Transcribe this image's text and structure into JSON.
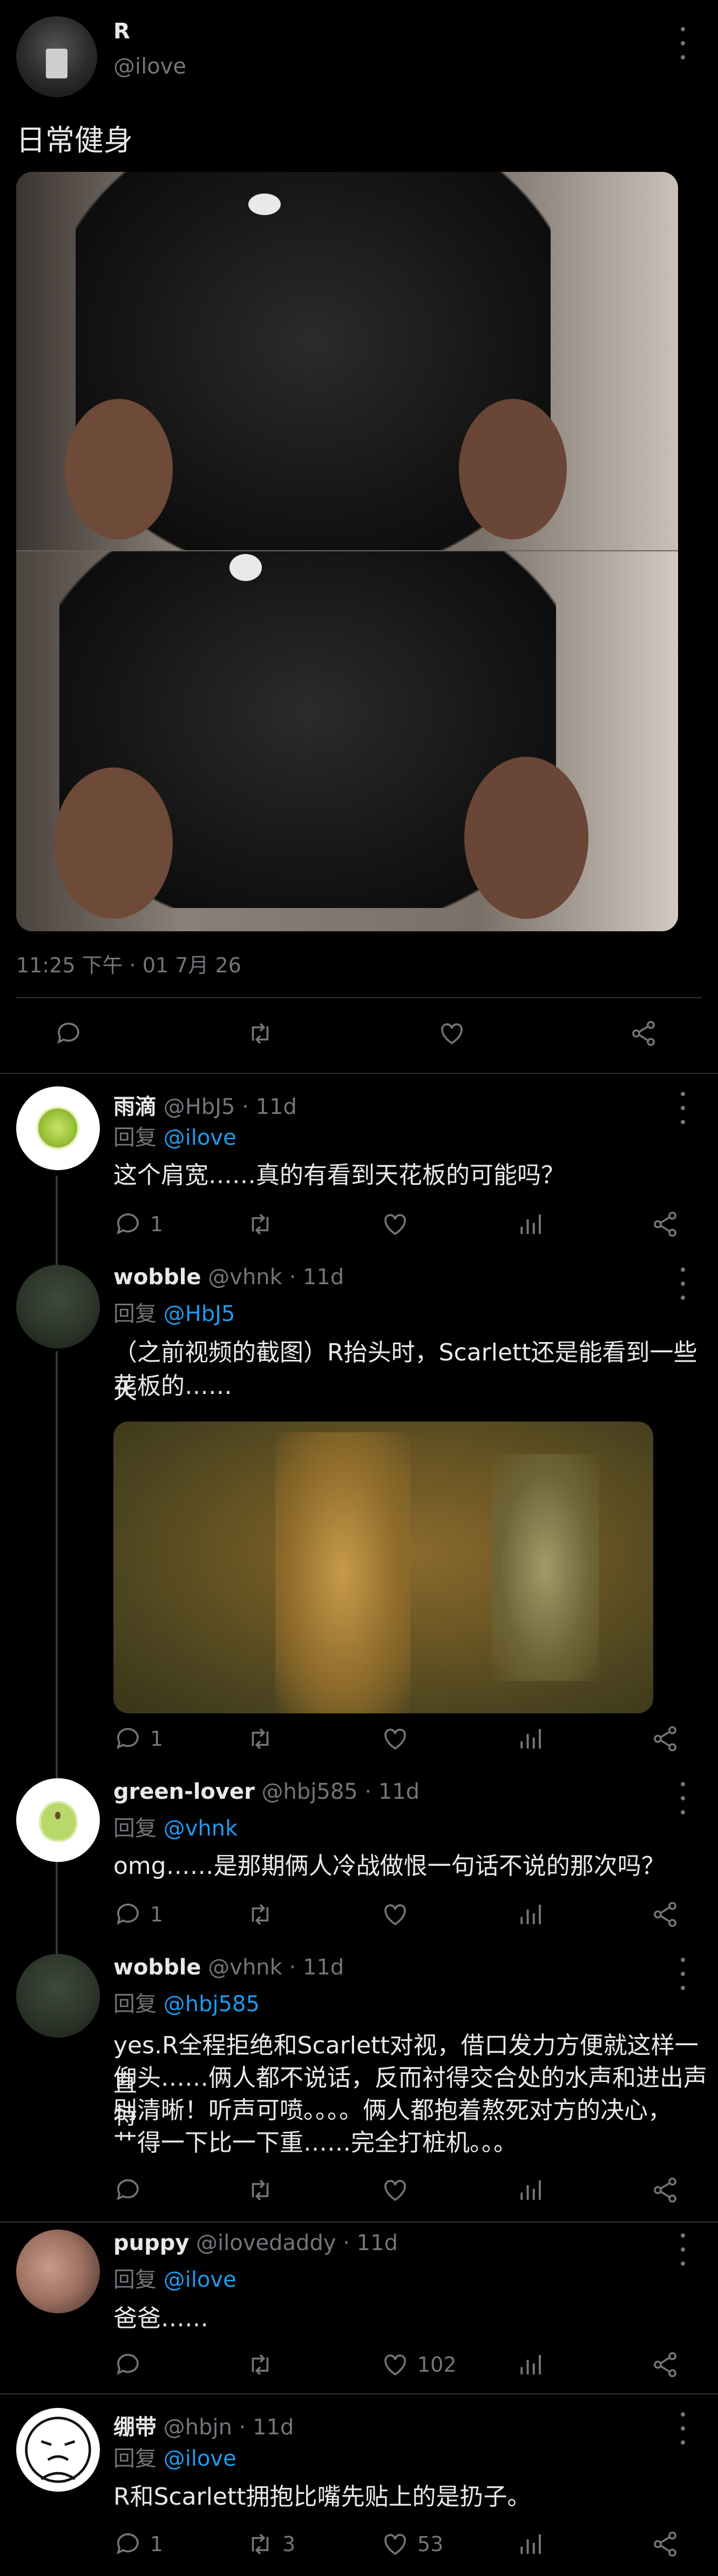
{
  "main_tweet": {
    "name": "R",
    "handle": "@ilove",
    "text": "日常健身",
    "timestamp": "11:25 下午 · 01 7月 26"
  },
  "replies": [
    {
      "name": "雨滴",
      "handle": "@HbJ5",
      "age": "· 11d",
      "reply_prefix": "回复",
      "reply_to": "@ilove",
      "text": "这个肩宽……真的有看到天花板的可能吗？",
      "comments": "1",
      "retweets": "",
      "likes": ""
    },
    {
      "name": "wobble",
      "handle": "@vhnk",
      "age": "· 11d",
      "reply_prefix": "回复",
      "reply_to": "@HbJ5",
      "text_line1": "（之前视频的截图）R抬头时，Scarlett还是能看到一些天",
      "text_line2": "花板的……",
      "comments": "1",
      "retweets": "",
      "likes": ""
    },
    {
      "name": "green-lover",
      "handle": "@hbj585",
      "age": "· 11d",
      "reply_prefix": "回复",
      "reply_to": "@vhnk",
      "text": "omg……是那期俩人冷战做恨一句话不说的那次吗？",
      "comments": "1",
      "retweets": "",
      "likes": ""
    },
    {
      "name": "wobble",
      "handle": "@vhnk",
      "age": "· 11d",
      "reply_prefix": "回复",
      "reply_to": "@hbj585",
      "text_line1": "yes.R全程拒绝和Scarlett对视，借口发力方便就这样一直",
      "text_line2": "仰头……俩人都不说话，反而衬得交合处的水声和进出声特",
      "text_line3": "别清晰！听声可喷。。。。俩人都抱着熬死对方的决心，",
      "text_line4": "艹得一下比一下重……完全打桩机。。。",
      "comments": "",
      "retweets": "",
      "likes": ""
    },
    {
      "name": "puppy",
      "handle": "@ilovedaddy",
      "age": "· 11d",
      "reply_prefix": "回复",
      "reply_to": "@ilove",
      "text": "爸爸……",
      "comments": "",
      "retweets": "",
      "likes": "102"
    },
    {
      "name": "绷带",
      "handle": "@hbjn",
      "age": "· 11d",
      "reply_prefix": "回复",
      "reply_to": "@ilove",
      "text": "R和Scarlett拥抱比嘴先贴上的是扔子。",
      "comments": "1",
      "retweets": "3",
      "likes": "53"
    }
  ],
  "colors": {
    "background": "#000000",
    "text": "#e7e9ea",
    "muted": "#71767b",
    "link": "#1d9bf0",
    "separator": "#2f3336"
  }
}
